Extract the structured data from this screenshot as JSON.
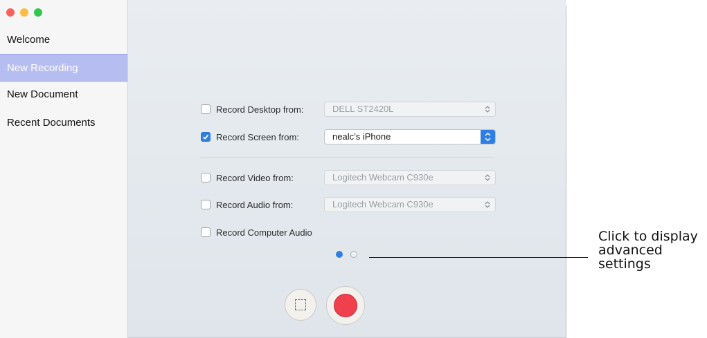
{
  "window": {
    "traffic_lights": [
      "close",
      "minimize",
      "zoom"
    ]
  },
  "sidebar": {
    "items": [
      {
        "label": "Welcome",
        "selected": false
      },
      {
        "label": "New Recording",
        "selected": true
      },
      {
        "label": "New Document",
        "selected": false
      },
      {
        "label": "Recent Documents",
        "selected": false
      }
    ]
  },
  "options": {
    "desktop": {
      "label": "Record Desktop from:",
      "checked": false,
      "value": "DELL ST2420L"
    },
    "screen": {
      "label": "Record Screen from:",
      "checked": true,
      "value": "nealc’s iPhone"
    },
    "video": {
      "label": "Record Video from:",
      "checked": false,
      "value": "Logitech Webcam C930e"
    },
    "audio": {
      "label": "Record Audio from:",
      "checked": false,
      "value": "Logitech Webcam C930e"
    },
    "computer_audio": {
      "label": "Record Computer Audio",
      "checked": false
    }
  },
  "pager": {
    "current": 1,
    "total": 2
  },
  "controls": {
    "region_icon": "selection-region-icon",
    "record_icon": "record-icon"
  },
  "callout": {
    "text": "Click to display advanced settings"
  },
  "colors": {
    "accent": "#2f7fe3",
    "selected_item": "#b6bdf0",
    "record": "#f0404d"
  }
}
